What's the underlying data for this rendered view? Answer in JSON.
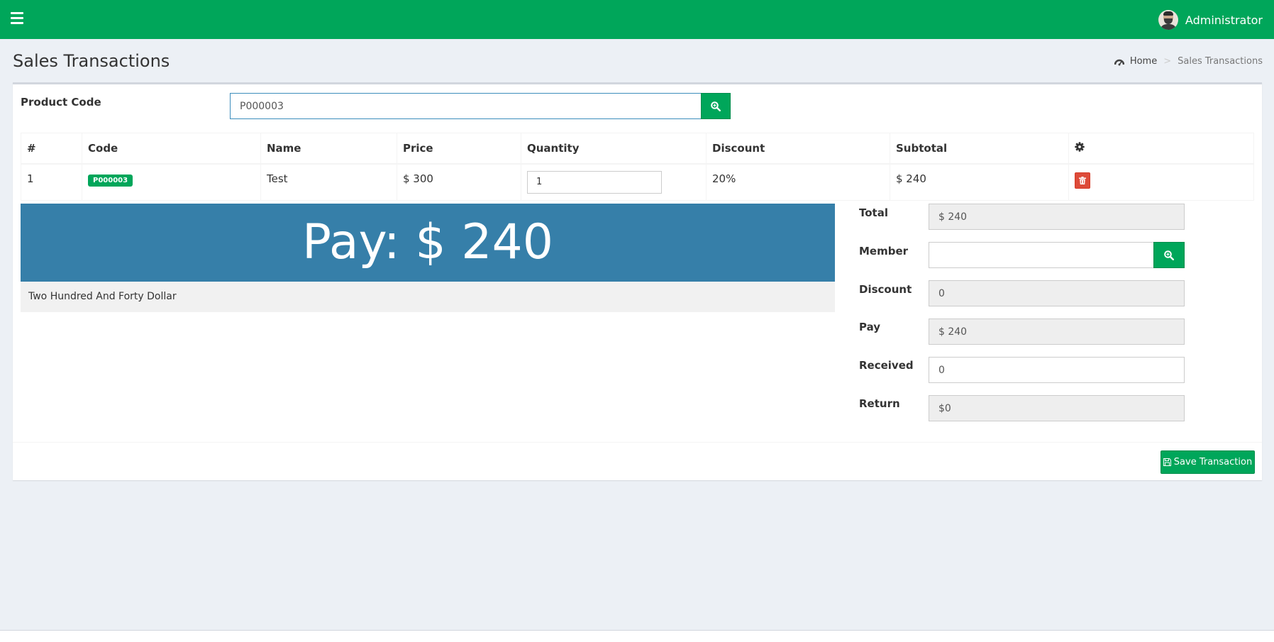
{
  "header": {
    "user_name": "Administrator",
    "menu_icon": "hamburger-icon",
    "avatar": "user-avatar"
  },
  "page": {
    "title": "Sales Transactions"
  },
  "breadcrumb": {
    "home": "Home",
    "current": "Sales Transactions",
    "home_icon": "dashboard-icon"
  },
  "product_search": {
    "label": "Product Code",
    "value": "P000003",
    "search_icon": "search-icon"
  },
  "table": {
    "headers": [
      "#",
      "Code",
      "Name",
      "Price",
      "Quantity",
      "Discount",
      "Subtotal"
    ],
    "settings_icon": "gear-icon",
    "rows": [
      {
        "no": "1",
        "code": "P000003",
        "name": "Test",
        "price": "$ 300",
        "quantity": "1",
        "discount": "20%",
        "subtotal": "$ 240",
        "delete_icon": "trash-icon"
      }
    ]
  },
  "pay": {
    "display": "Pay: $ 240",
    "words": "Two Hundred And Forty Dollar"
  },
  "summary": {
    "total_label": "Total",
    "total_value": "$ 240",
    "member_label": "Member",
    "member_value": "",
    "discount_label": "Discount",
    "discount_value": "0",
    "pay_label": "Pay",
    "pay_value": "$ 240",
    "received_label": "Received",
    "received_value": "0",
    "return_label": "Return",
    "return_value": "$0"
  },
  "actions": {
    "save_label": "Save Transaction",
    "save_icon": "save-icon"
  },
  "colors": {
    "brand": "#00a65a",
    "pay_banner": "#367fa9",
    "danger": "#dd4b39"
  }
}
